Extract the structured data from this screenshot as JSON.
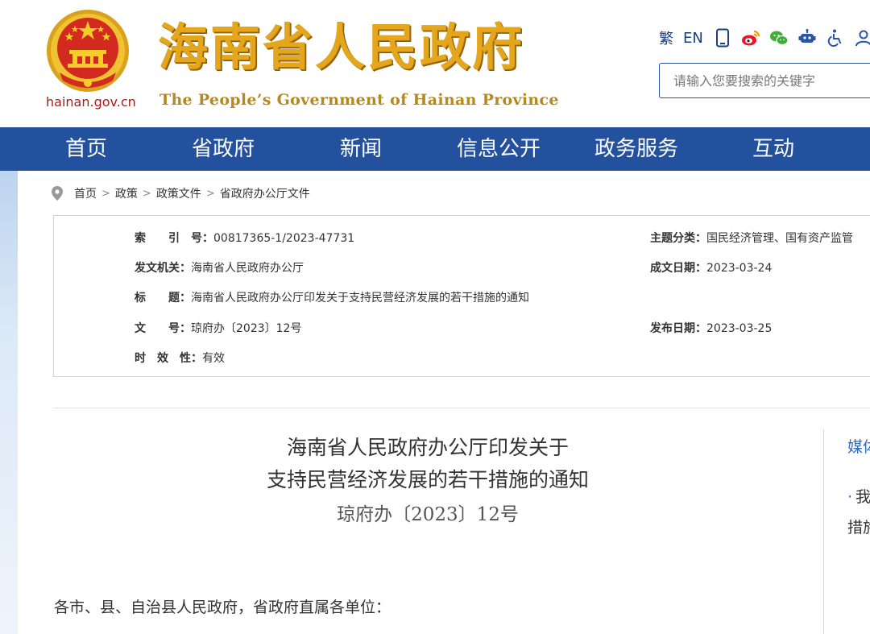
{
  "header": {
    "domain_text": "hainan.gov.cn",
    "site_title_cn": "海南省人民政府",
    "site_title_en": "The People’s Government  of Hainan Province",
    "traditional_label": "繁",
    "english_label": "EN",
    "search_placeholder": "请输入您要搜索的关键字"
  },
  "nav": {
    "items": [
      "首页",
      "省政府",
      "新闻",
      "信息公开",
      "政务服务",
      "互动"
    ]
  },
  "breadcrumb": [
    "首页",
    "政策",
    "政策文件",
    "省政府办公厅文件"
  ],
  "meta": {
    "index_label": "索　　引　号：",
    "index_value": "00817365-1/2023-47731",
    "topic_label": "主题分类：",
    "topic_value": "国民经济管理、国有资产监管",
    "issuer_label": "发文机关：",
    "issuer_value": "海南省人民政府办公厅",
    "created_label": "成文日期：",
    "created_value": "2023-03-24",
    "title_label": "标　　题：",
    "title_value": "海南省人民政府办公厅印发关于支持民营经济发展的若干措施的通知",
    "docno_label": "文　　号：",
    "docno_value": "琼府办〔2023〕12号",
    "published_label": "发布日期：",
    "published_value": "2023-03-25",
    "validity_label": "时　效　性：",
    "validity_value": "有效"
  },
  "article": {
    "title_line1": "海南省人民政府办公厅印发关于",
    "title_line2": "支持民营经济发展的若干措施的通知",
    "doc_number": "琼府办〔2023〕12号",
    "salutation": "各市、县、自治县人民政府，省政府直属各单位："
  },
  "side": {
    "heading": "媒体",
    "item_line1": "我",
    "item_line2": "措施"
  },
  "colors": {
    "nav_bg": "#23519e",
    "title_gold": "#e3a61c",
    "link_blue": "#2a6ec7"
  },
  "icons": [
    "tablet-icon",
    "weibo-icon",
    "wechat-icon",
    "robot-icon",
    "accessibility-icon",
    "user-icon"
  ]
}
